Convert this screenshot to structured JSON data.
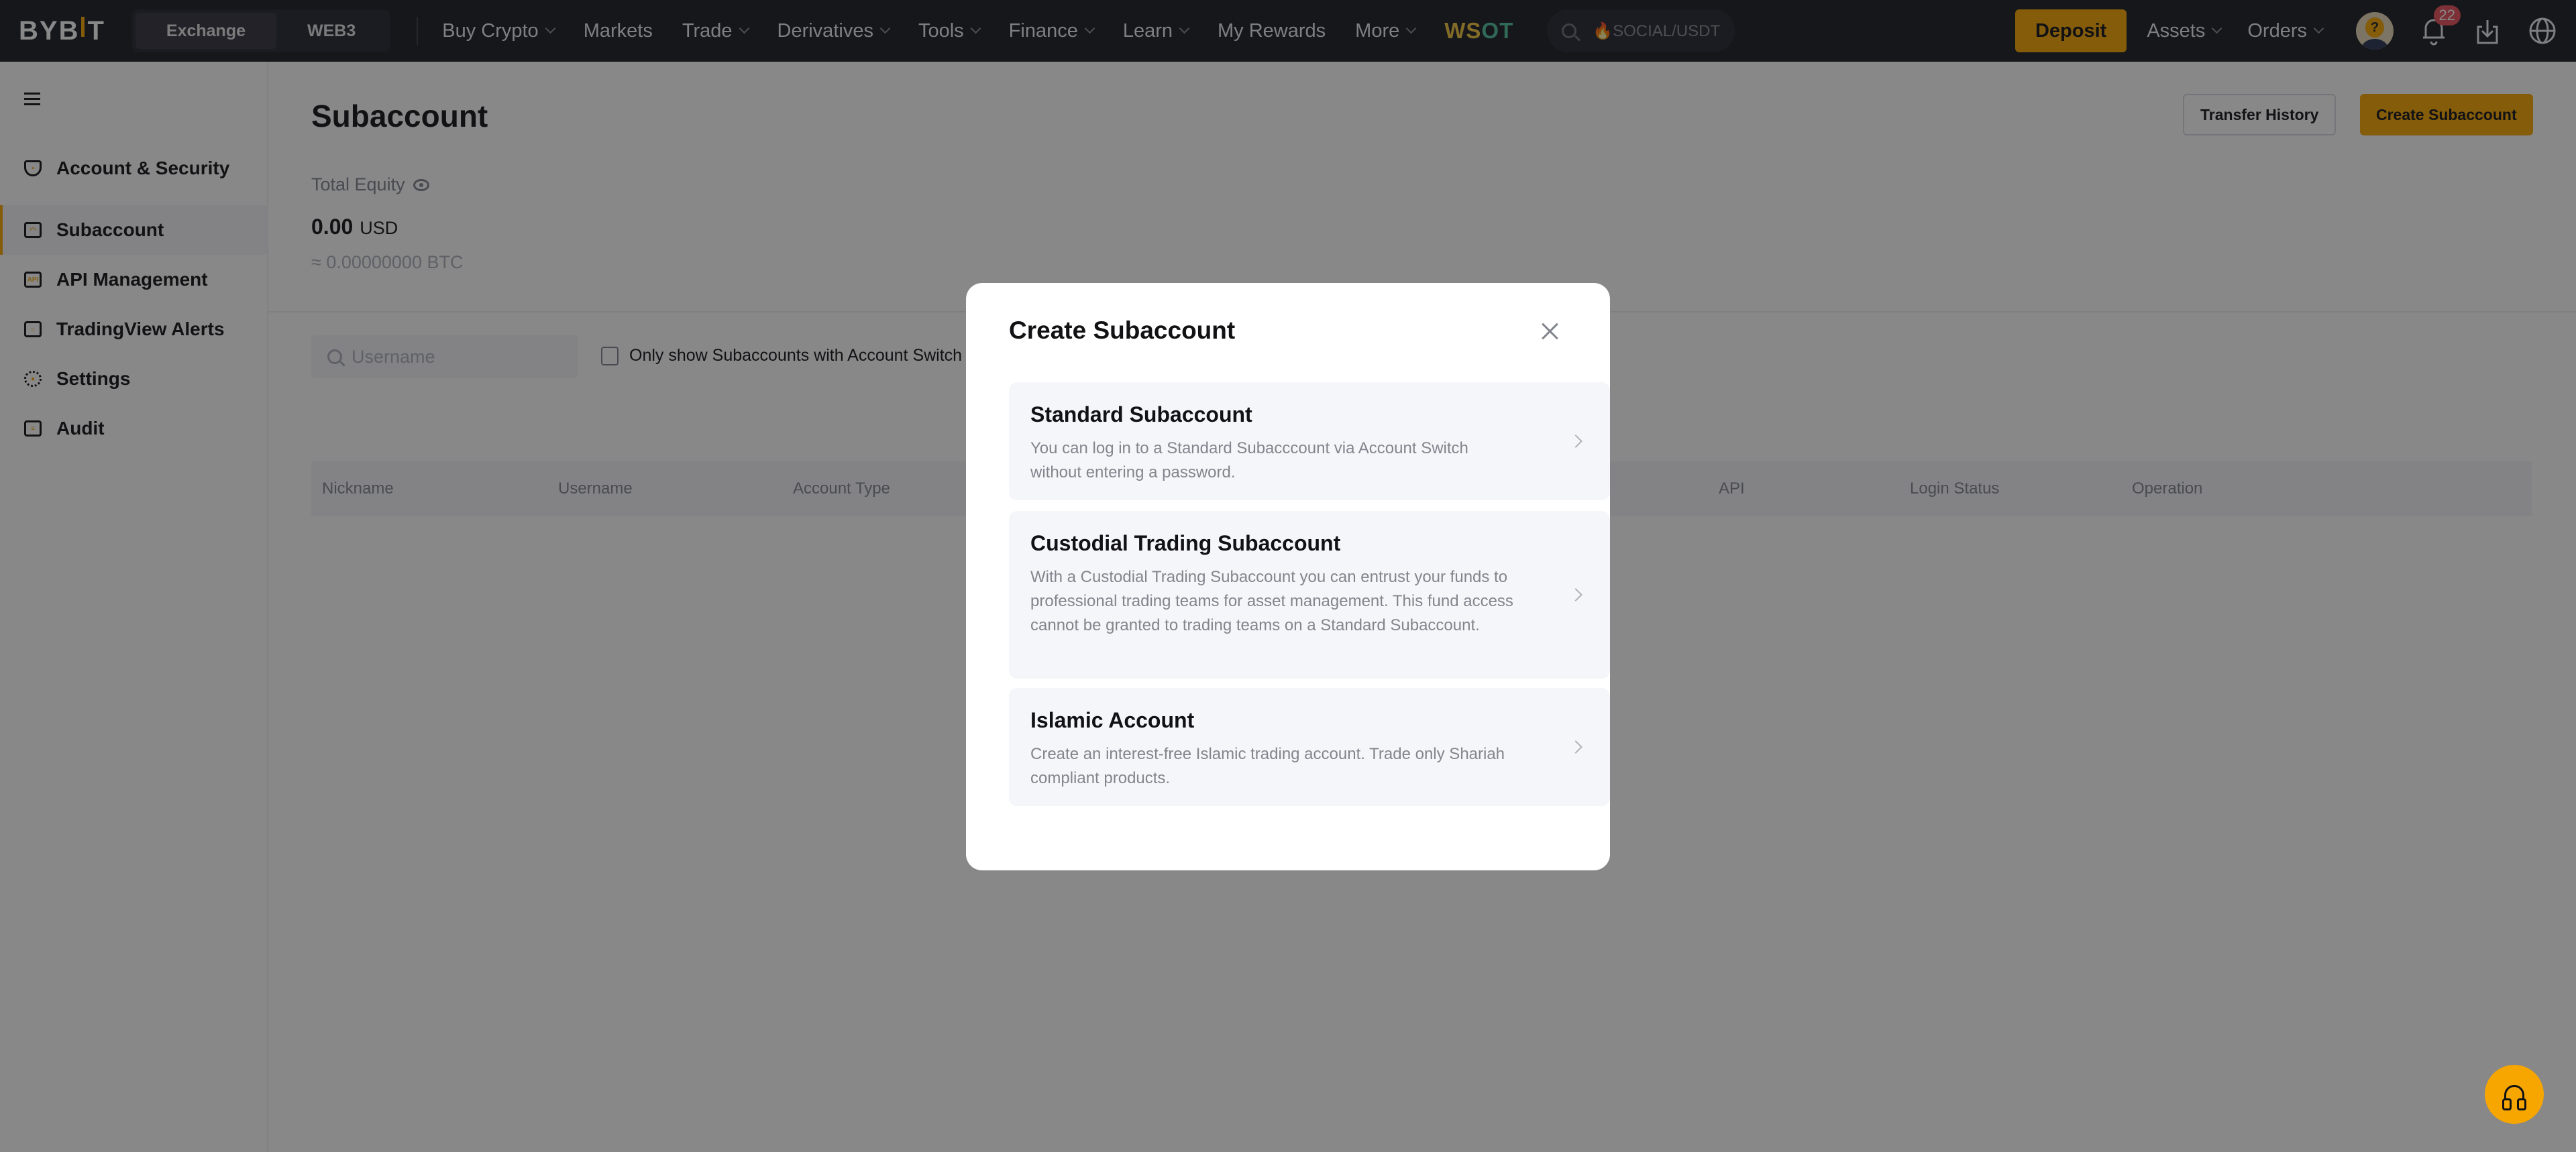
{
  "topbar": {
    "logo": "BYB|T",
    "segments": [
      {
        "label": "Exchange",
        "active": true
      },
      {
        "label": "WEB3",
        "active": false
      }
    ],
    "nav": [
      {
        "label": "Buy Crypto",
        "dropdown": true
      },
      {
        "label": "Markets",
        "dropdown": false
      },
      {
        "label": "Trade",
        "dropdown": true
      },
      {
        "label": "Derivatives",
        "dropdown": true
      },
      {
        "label": "Tools",
        "dropdown": true
      },
      {
        "label": "Finance",
        "dropdown": true
      },
      {
        "label": "Learn",
        "dropdown": true
      },
      {
        "label": "My Rewards",
        "dropdown": false
      },
      {
        "label": "More",
        "dropdown": true
      }
    ],
    "promo": {
      "part_a": "WS",
      "part_b": "OT"
    },
    "search": {
      "icon": "search-icon",
      "hot_icon": "🔥",
      "text": "SOCIAL/USDT"
    },
    "deposit_label": "Deposit",
    "assets_label": "Assets",
    "orders_label": "Orders",
    "avatar_glyph": "?",
    "notification_count": "22",
    "icons": [
      "avatar",
      "bell-icon",
      "download-icon",
      "globe-icon"
    ]
  },
  "sidebar": {
    "collapse_icon": "collapse-menu-icon",
    "items": [
      {
        "label": "Account & Security",
        "icon": "shield-icon",
        "active": false
      },
      {
        "label": "Subaccount",
        "icon": "subaccount-icon",
        "active": true
      },
      {
        "label": "API Management",
        "icon": "api-icon",
        "icon_text": "API",
        "active": false
      },
      {
        "label": "TradingView Alerts",
        "icon": "tradingview-alert-icon",
        "active": false
      },
      {
        "label": "Settings",
        "icon": "gear-icon",
        "active": false
      },
      {
        "label": "Audit",
        "icon": "clipboard-icon",
        "active": false
      }
    ]
  },
  "main": {
    "title": "Subaccount",
    "transfer_history_label": "Transfer History",
    "create_subaccount_label": "Create Subaccount",
    "total_equity_label": "Total Equity",
    "equity_value": "0.00",
    "equity_unit": "USD",
    "equity_btc": "≈ 0.00000000 BTC",
    "search_placeholder": "Username",
    "search_value": "",
    "filter_label": "Only show Subaccounts with Account Switch e",
    "filter_checked": false,
    "columns": [
      "Nickname",
      "Username",
      "Account Type",
      "API",
      "Login Status",
      "Operation"
    ]
  },
  "modal": {
    "title": "Create Subaccount",
    "options": [
      {
        "title": "Standard Subaccount",
        "description": "You can log in to a Standard Subacccount via Account Switch without entering a password."
      },
      {
        "title": "Custodial Trading Subaccount",
        "description": "With a Custodial Trading Subaccount you can entrust your funds to professional trading teams for asset management. This fund access cannot be granted to trading teams on a Standard Subaccount."
      },
      {
        "title": "Islamic Account",
        "description": "Create an interest-free Islamic trading account. Trade only Shariah compliant products."
      }
    ]
  },
  "support": {
    "icon": "headset-icon"
  },
  "colors": {
    "brand": "#f7a600",
    "topbar_bg": "#1b1c22",
    "badge": "#e8505b",
    "text_primary": "#121214",
    "text_secondary": "#81858c"
  }
}
